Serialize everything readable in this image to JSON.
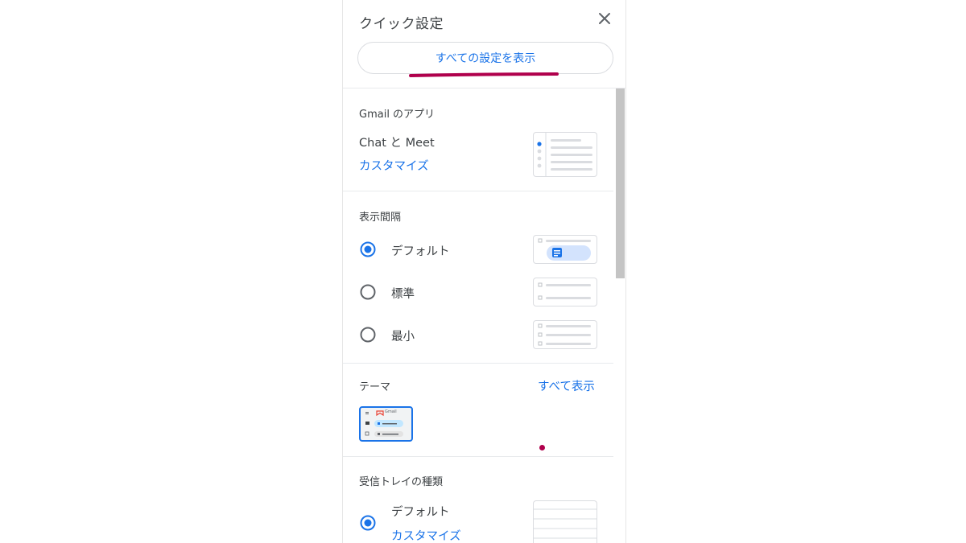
{
  "header": {
    "title": "クイック設定",
    "all_settings_label": "すべての設定を表示"
  },
  "gmail_apps": {
    "title": "Gmail のアプリ",
    "item_label": "Chat と Meet",
    "customize_label": "カスタマイズ"
  },
  "density": {
    "title": "表示間隔",
    "options": [
      {
        "label": "デフォルト",
        "selected": true
      },
      {
        "label": "標準",
        "selected": false
      },
      {
        "label": "最小",
        "selected": false
      }
    ]
  },
  "theme": {
    "title": "テーマ",
    "view_all_label": "すべて表示",
    "preview_logo_text": "Gmail"
  },
  "inbox_type": {
    "title": "受信トレイの種類",
    "option_label": "デフォルト",
    "customize_label": "カスタマイズ"
  },
  "colors": {
    "accent": "#1a73e8",
    "annotation": "#b0004c"
  }
}
